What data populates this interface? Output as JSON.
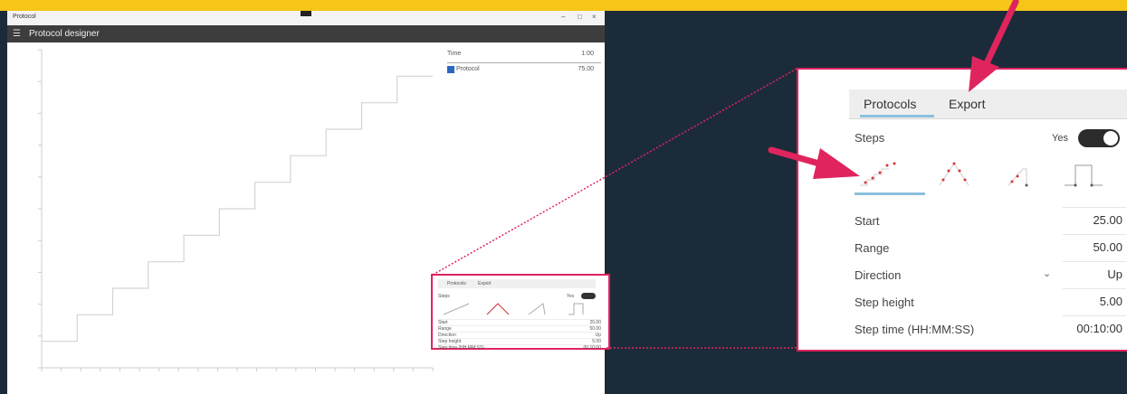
{
  "window": {
    "app_name": "Protocol",
    "header_title": "Protocol designer",
    "menu_icon": "hamburger-icon",
    "controls": [
      "–",
      "□",
      "×"
    ]
  },
  "legend": {
    "time_label": "Time",
    "time_value": "1:00",
    "series_label": "Protocol",
    "series_value": "75.00"
  },
  "panel": {
    "tabs": [
      "Protocols",
      "Export"
    ],
    "steps_label": "Steps",
    "toggle_label": "Yes",
    "fields": [
      {
        "label": "Start",
        "value": "25.00"
      },
      {
        "label": "Range",
        "value": "50.00"
      },
      {
        "label": "Direction",
        "value": "Up",
        "has_dropdown": true
      },
      {
        "label": "Step height",
        "value": "5.00"
      },
      {
        "label": "Step time (HH:MM:SS)",
        "value": "00:10:00"
      }
    ],
    "shape_icons": [
      "staircase-up-icon",
      "triangle-icon",
      "ramp-pulse-icon",
      "square-pulse-icon"
    ]
  },
  "chart_data": {
    "type": "line",
    "x": [
      0,
      1,
      1,
      2,
      2,
      3,
      3,
      4,
      4,
      5,
      5,
      6,
      6,
      7,
      7,
      8,
      8,
      9,
      9,
      10,
      10,
      11
    ],
    "series": [
      {
        "values": [
          25,
          25,
          30,
          30,
          35,
          35,
          40,
          40,
          45,
          45,
          50,
          50,
          55,
          55,
          60,
          60,
          65,
          65,
          70,
          70,
          75,
          75
        ]
      }
    ],
    "ylim": [
      20,
      80
    ],
    "xlim": [
      0,
      11
    ],
    "grid": false
  },
  "colors": {
    "accent_pink": "#e0245e",
    "banner_yellow": "#f5c518",
    "tab_underline": "#8cc0dd",
    "background": "#1c2b3a"
  }
}
